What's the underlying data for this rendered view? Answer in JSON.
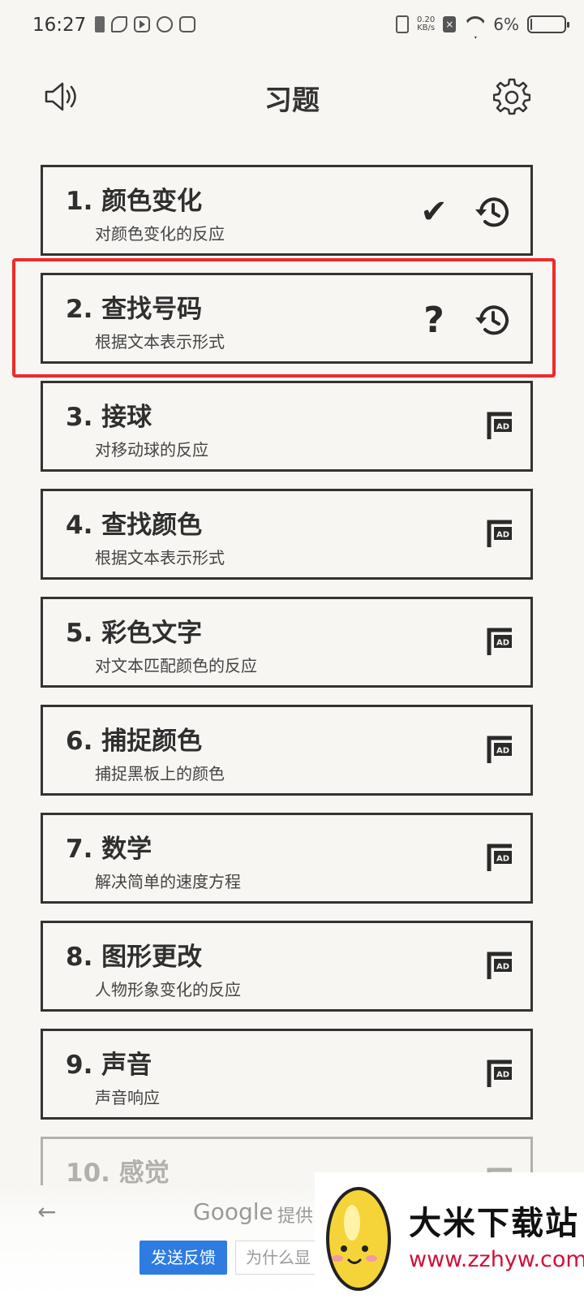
{
  "status_bar": {
    "time": "16:27",
    "net_speed_value": "0.20",
    "net_speed_unit": "KB/s",
    "battery_percent": "6%",
    "battery_level": 0.06,
    "icons": [
      "sim-icon",
      "leaf-app-icon",
      "play-app-icon",
      "q-app-icon",
      "chat-app-icon",
      "vibrate-icon",
      "no-sim-icon",
      "wifi-icon",
      "battery-icon"
    ]
  },
  "header": {
    "title": "习题",
    "left_icon": "speaker-icon",
    "right_icon": "gear-icon"
  },
  "exercises": [
    {
      "title": "1. 颜色变化",
      "subtitle": "对颜色变化的反应",
      "status": "✔",
      "status_icon": "checkmark-icon",
      "history": true,
      "ad": false
    },
    {
      "title": "2. 查找号码",
      "subtitle": "根据文本表示形式",
      "status": "?",
      "status_icon": "question-icon",
      "history": true,
      "ad": false
    },
    {
      "title": "3. 接球",
      "subtitle": "对移动球的反应",
      "status": "",
      "history": false,
      "ad": true
    },
    {
      "title": "4. 查找颜色",
      "subtitle": "根据文本表示形式",
      "status": "",
      "history": false,
      "ad": true
    },
    {
      "title": "5. 彩色文字",
      "subtitle": "对文本匹配颜色的反应",
      "status": "",
      "history": false,
      "ad": true
    },
    {
      "title": "6. 捕捉颜色",
      "subtitle": "捕捉黑板上的颜色",
      "status": "",
      "history": false,
      "ad": true
    },
    {
      "title": "7. 数学",
      "subtitle": "解决简单的速度方程",
      "status": "",
      "history": false,
      "ad": true
    },
    {
      "title": "8. 图形更改",
      "subtitle": "人物形象变化的反应",
      "status": "",
      "history": false,
      "ad": true
    },
    {
      "title": "9. 声音",
      "subtitle": "声音响应",
      "status": "",
      "history": false,
      "ad": true
    },
    {
      "title": "10. 感觉",
      "subtitle": "",
      "status": "",
      "history": false,
      "ad": true
    }
  ],
  "highlight_color": "#ee2a2a",
  "ad_bar": {
    "back": "←",
    "google": "Google",
    "provided_by": "提供",
    "feedback_button": "发送反馈",
    "why_button": "为什么显"
  },
  "watermark": {
    "title": "大米下载站",
    "url": "www.zzhyw.com"
  }
}
